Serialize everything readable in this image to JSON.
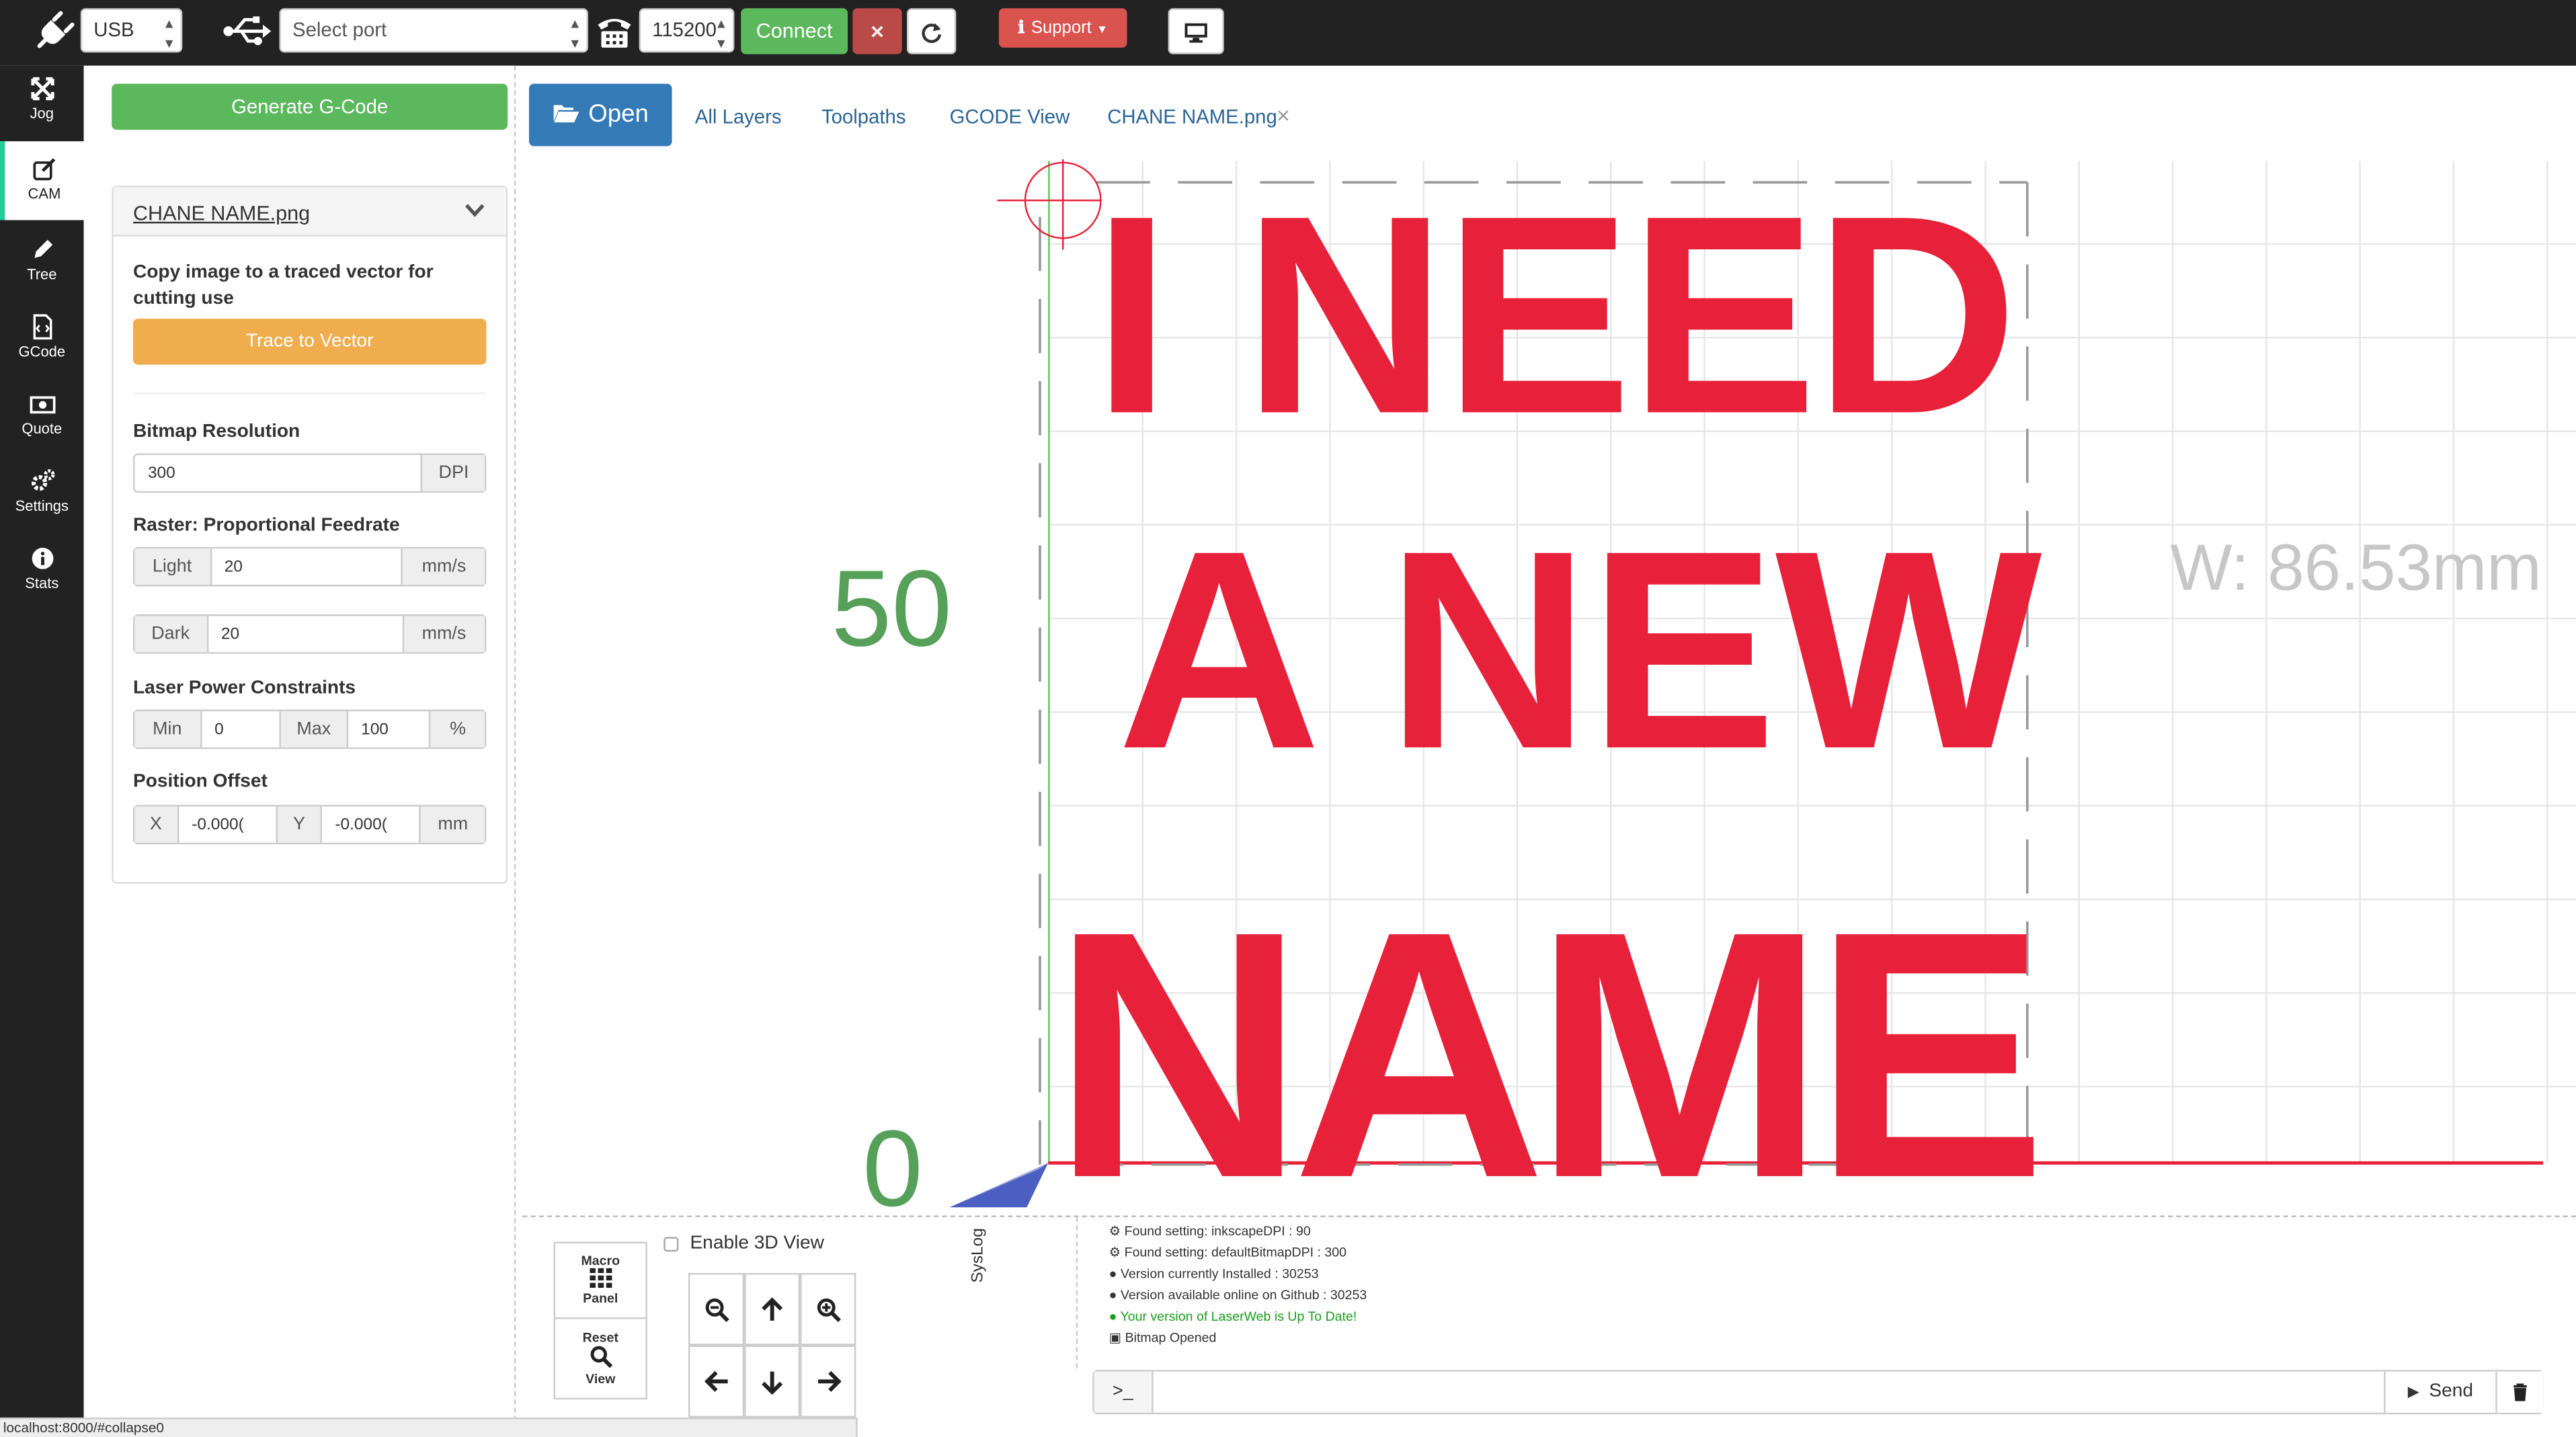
{
  "topbar": {
    "connection_type": "USB",
    "port_placeholder": "Select port",
    "baud_rate": "115200",
    "connect_label": "Connect",
    "close_label": "×",
    "support_label": "Support"
  },
  "sidebar": {
    "items": [
      {
        "label": "Jog",
        "icon": "move-icon"
      },
      {
        "label": "CAM",
        "icon": "edit-icon",
        "active": true
      },
      {
        "label": "Tree",
        "icon": "pencil-icon"
      },
      {
        "label": "GCode",
        "icon": "file-code-icon"
      },
      {
        "label": "Quote",
        "icon": "money-icon"
      },
      {
        "label": "Settings",
        "icon": "gears-icon"
      },
      {
        "label": "Stats",
        "icon": "info-icon"
      }
    ]
  },
  "cam": {
    "generate_label": "Generate G-Code",
    "file_title": "CHANE NAME.png",
    "trace_desc": "Copy image to a traced vector for cutting use",
    "trace_label": "Trace to Vector",
    "bitmap_resolution_label": "Bitmap Resolution",
    "bitmap_resolution_value": "300",
    "bitmap_resolution_unit": "DPI",
    "raster_label": "Raster: Proportional Feedrate",
    "light_label": "Light",
    "light_value": "20",
    "light_unit": "mm/s",
    "dark_label": "Dark",
    "dark_value": "20",
    "dark_unit": "mm/s",
    "power_label": "Laser Power Constraints",
    "min_label": "Min",
    "min_value": "0",
    "max_label": "Max",
    "max_value": "100",
    "power_unit": "%",
    "offset_label": "Position Offset",
    "x_label": "X",
    "x_value": "-0.000(",
    "y_label": "Y",
    "y_value": "-0.000(",
    "offset_unit": "mm"
  },
  "tabs": {
    "open_label": "Open",
    "all_layers": "All Layers",
    "toolpaths": "Toolpaths",
    "gcode_view": "GCODE View",
    "file_tab": "CHANE NAME.png",
    "file_close": "×"
  },
  "viewport": {
    "line1": "I NEED",
    "line2": "A NEW",
    "line3": "NAME",
    "y_label_50": "50",
    "y_label_0": "0",
    "width_readout": "W: 86.53mm"
  },
  "bottom": {
    "macro_label_1": "Macro",
    "macro_label_2": "Panel",
    "reset_label_1": "Reset",
    "reset_label_2": "View",
    "enable_3d": "Enable 3D View",
    "syslog": "SysLog",
    "send_label": "Send",
    "prompt": ">_",
    "log": [
      {
        "text": "Found setting: inkscapeDPI : 90",
        "color": "#333333",
        "icon": "gears-icon"
      },
      {
        "text": "Found setting: defaultBitmapDPI : 300",
        "color": "#333333",
        "icon": "gears-icon"
      },
      {
        "text": "Version currently Installed : 30253",
        "color": "#333333",
        "icon": "github-icon"
      },
      {
        "text": "Version available online on Github : 30253",
        "color": "#333333",
        "icon": "github-icon"
      },
      {
        "text": "Your version of LaserWeb is Up To Date!",
        "color": "#1a9c1a",
        "icon": "github-icon"
      },
      {
        "text": "Bitmap Opened",
        "color": "#333333",
        "icon": "image-file-icon"
      }
    ]
  },
  "statusbar": {
    "url": "localhost:8000/#collapse0"
  }
}
